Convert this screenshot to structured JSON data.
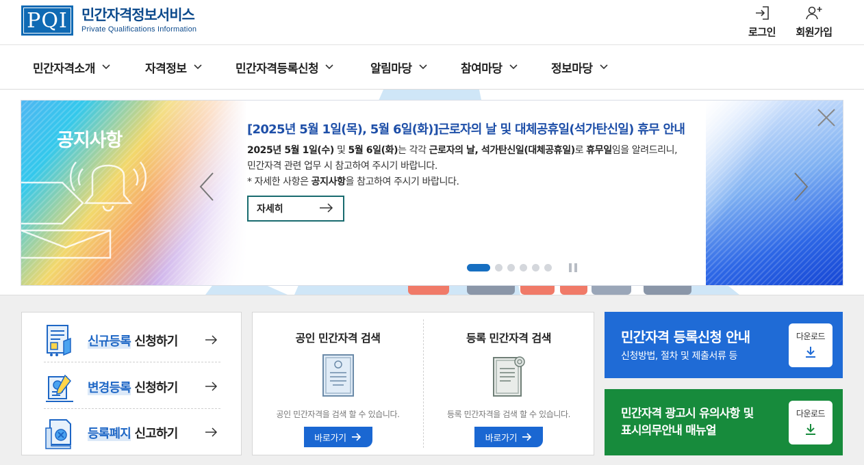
{
  "header": {
    "logo_mark": "PQI",
    "logo_title": "민간자격정보서비스",
    "logo_subtitle": "Private Qualifications Information",
    "login_label": "로그인",
    "signup_label": "회원가입"
  },
  "gnb": {
    "items": [
      {
        "label": "민간자격소개"
      },
      {
        "label": "자격정보"
      },
      {
        "label": "민간자격등록신청"
      },
      {
        "label": "알림마당"
      },
      {
        "label": "참여마당"
      },
      {
        "label": "정보마당"
      }
    ]
  },
  "notice": {
    "label": "공지사항",
    "title": "[2025년 5월 1일(목), 5월 6일(화)]근로자의 날 및 대체공휴일(석가탄신일) 휴무 안내",
    "line1": {
      "p1": "2025년 5월 1일(수)",
      "p2": " 및 ",
      "p3": "5월 6일(화)",
      "p4": "는 각각 ",
      "p5": "근로자의 날, 석가탄신일(대체공휴일)",
      "p6": "로 ",
      "p7": "휴무일",
      "p8": "임을 알려드리니,"
    },
    "line2": "민간자격 관련 업무 시 참고하여 주시기 바랍니다.",
    "line3": {
      "p1": "* 자세한 사항은 ",
      "p2": "공지사항",
      "p3": "을 참고하여 주시기 바랍니다."
    },
    "more_label": "자세히",
    "slide_count": 6,
    "active_slide": 1
  },
  "registration": {
    "items": [
      {
        "highlight": "신규등록",
        "rest": " 신청하기",
        "icon": "new-registration-icon"
      },
      {
        "highlight": "변경등록",
        "rest": " 신청하기",
        "icon": "change-registration-icon"
      },
      {
        "highlight": "등록폐지",
        "rest": " 신고하기",
        "icon": "abolish-registration-icon"
      }
    ]
  },
  "search": {
    "public": {
      "title": "공인 민간자격 검색",
      "desc": "공인 민간자격을 검색 할 수 있습니다.",
      "button": "바로가기"
    },
    "registered": {
      "title": "등록 민간자격 검색",
      "desc": "등록 민간자격을 검색 할 수 있습니다.",
      "button": "바로가기"
    }
  },
  "guides": [
    {
      "title": "민간자격 등록신청 안내",
      "subtitle": "신청방법, 절차 및 제출서류 등",
      "download": "다운로드",
      "color": "#1f6bd6"
    },
    {
      "title_line1": "민간자격 광고시 유의사항 및",
      "title_line2": "표시의무안내 매뉴얼",
      "download": "다운로드",
      "color": "#178b3c"
    }
  ],
  "colors": {
    "brand_blue": "#0f6ab4",
    "notice_title": "#1e4fa8",
    "button_blue": "#1a67d2",
    "guide_green": "#178b3c"
  }
}
